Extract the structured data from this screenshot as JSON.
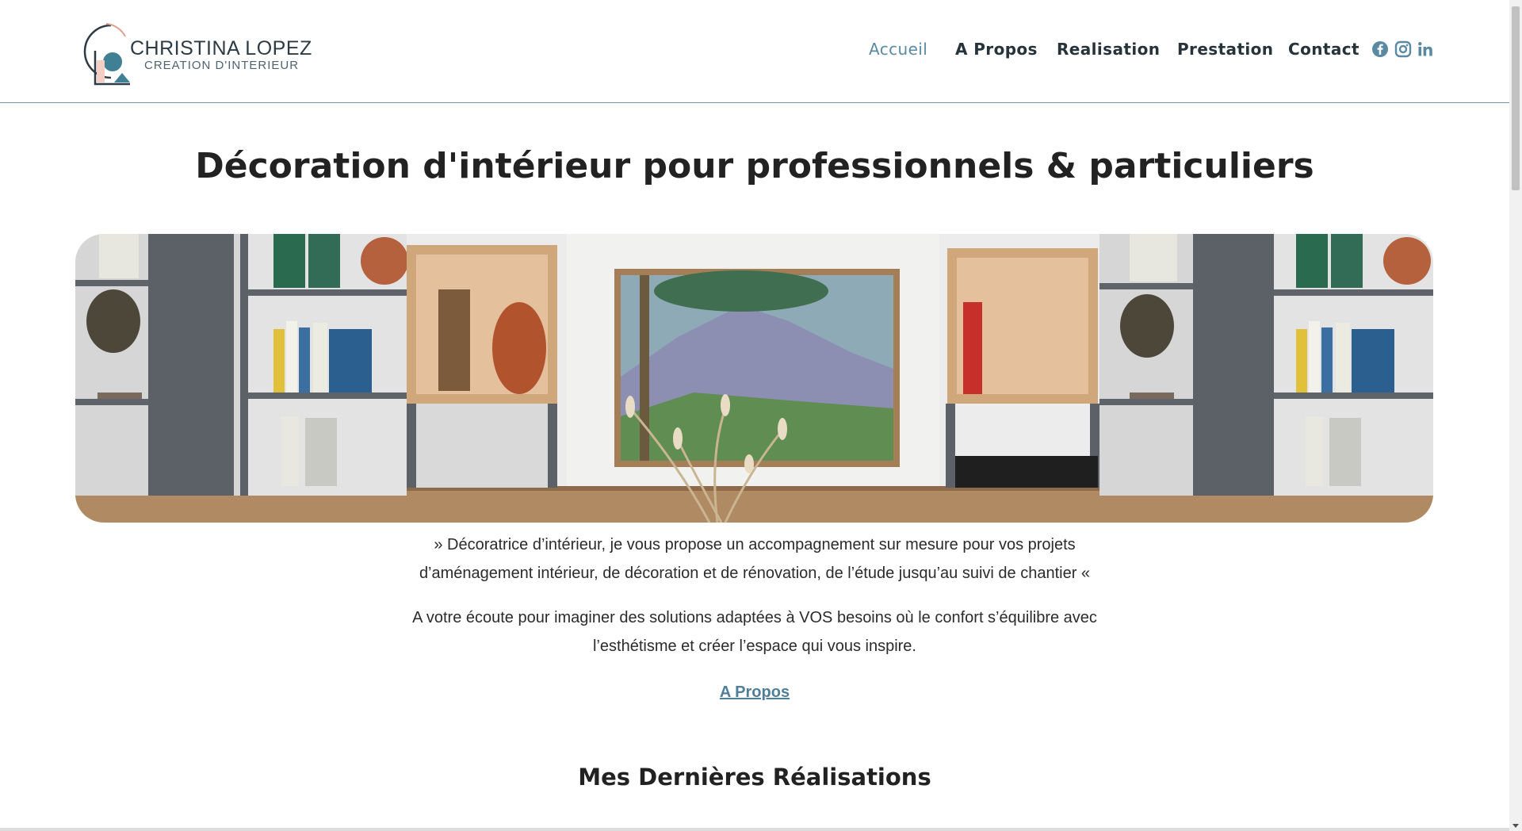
{
  "brand": {
    "name": "CHRISTINA LOPEZ",
    "tagline": "CREATION D'INTERIEUR",
    "colors": {
      "accent": "#5a8aa3",
      "teal": "#3f8094",
      "salmon": "#d9a08e",
      "dark": "#2c3b44"
    }
  },
  "nav": {
    "items": [
      {
        "label": "Accueil",
        "active": true
      },
      {
        "label": "A Propos",
        "active": false
      },
      {
        "label": "Realisation",
        "active": false
      },
      {
        "label": "Prestation",
        "active": false
      },
      {
        "label": "Contact",
        "active": false
      }
    ],
    "social": [
      "facebook-icon",
      "instagram-icon",
      "linkedin-icon"
    ]
  },
  "hero": {
    "title": "Décoration d'intérieur pour professionnels & particuliers"
  },
  "intro": {
    "quote_line1": "» Décoratrice d’intérieur, je vous propose un accompagnement sur mesure pour vos projets",
    "quote_line2": "d’aménagement intérieur, de décoration et de rénovation, de l’étude jusqu’au suivi de chantier «",
    "text_line1": "A votre écoute pour imaginer des solutions adaptées à VOS besoins où le confort s’équilibre avec",
    "text_line2": "l’esthétisme et créer l’espace qui vous inspire.",
    "link_label": "A Propos"
  },
  "section": {
    "title": "Mes Dernières Réalisations"
  }
}
